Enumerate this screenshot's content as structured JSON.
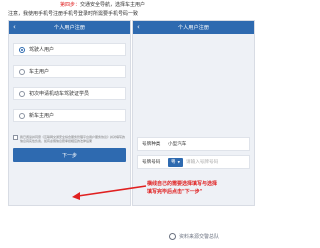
{
  "caption": {
    "step_label": "第四步：",
    "step_text": "交通安全导航，选择车主用户",
    "sub_prefix": "注意，",
    "sub_text": "我使用手机号注册手机号登录时所需要手机号码一致"
  },
  "left_phone": {
    "title": "个人用户注册",
    "back_icon": "‹",
    "options": [
      {
        "label": "驾驶人用户",
        "selected": true
      },
      {
        "label": "车主用户",
        "selected": false
      },
      {
        "label": "初次申请机动车驾驶证学员",
        "selected": false
      },
      {
        "label": "新车主用户",
        "selected": false
      }
    ],
    "agreement": "我已阅读并同意《互联网交通安全综合服务管理平台用户服务协议》并对填写的信息真实性负责，如有虚假信息愿承担相应的法律后果",
    "next_button": "下一步"
  },
  "right_phone": {
    "title": "个人用户注册",
    "back_icon": "‹",
    "fields": [
      {
        "label": "号牌种类",
        "value": "小型汽车"
      },
      {
        "label": "号牌号码",
        "prefix": "粤",
        "placeholder": "请输入号牌号码"
      }
    ]
  },
  "annotation": {
    "line1": "横线自己的需要选择填写与选择",
    "line2": "填写完毕后点击\"下一步\""
  },
  "watermark": {
    "text": "资料来源交警总队"
  },
  "colors": {
    "brand": "#2e6ab0",
    "annotation": "#e02020"
  },
  "icons": {
    "back": "chevron-left-icon",
    "radio": "radio-icon",
    "checkbox": "checkbox-icon",
    "dropdown": "caret-down-icon"
  }
}
